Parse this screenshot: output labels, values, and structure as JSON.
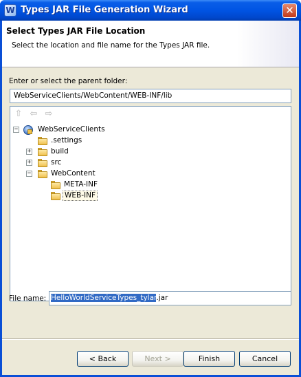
{
  "window": {
    "title": "Types JAR File Generation Wizard",
    "app_icon_glyph": "W",
    "close_glyph": "✕"
  },
  "header": {
    "title": "Select Types JAR File Location",
    "description": "Select the location and file name for the Types JAR file."
  },
  "parent_folder": {
    "label": "Enter or select the parent folder:",
    "value": "WebServiceClients/WebContent/WEB-INF/lib"
  },
  "tree_toolbar": {
    "icons": [
      "up-folder-icon",
      "back-arrow-icon",
      "forward-arrow-icon"
    ]
  },
  "tree": {
    "items": [
      {
        "label": "WebServiceClients",
        "icon": "project-icon",
        "expander": "−",
        "selected": false
      },
      {
        "label": ".settings",
        "icon": "folder-icon",
        "expander": "",
        "selected": false
      },
      {
        "label": "build",
        "icon": "folder-icon",
        "expander": "+",
        "selected": false
      },
      {
        "label": "src",
        "icon": "folder-icon",
        "expander": "+",
        "selected": false
      },
      {
        "label": "WebContent",
        "icon": "folder-open-icon",
        "expander": "−",
        "selected": false
      },
      {
        "label": "META-INF",
        "icon": "folder-icon",
        "expander": "",
        "selected": false
      },
      {
        "label": "WEB-INF",
        "icon": "folder-icon",
        "expander": "",
        "selected": true
      }
    ]
  },
  "file_name": {
    "label": "File name:",
    "selected_part": "HelloWorldServiceTypes_tylar",
    "rest": ".jar"
  },
  "buttons": {
    "back": "< Back",
    "next": "Next >",
    "finish": "Finish",
    "cancel": "Cancel",
    "next_enabled": false
  },
  "colors": {
    "titlebar": "#0054e3",
    "dialog_bg": "#ece9d8",
    "selection": "#316ac5",
    "input_border": "#7f9db9"
  }
}
